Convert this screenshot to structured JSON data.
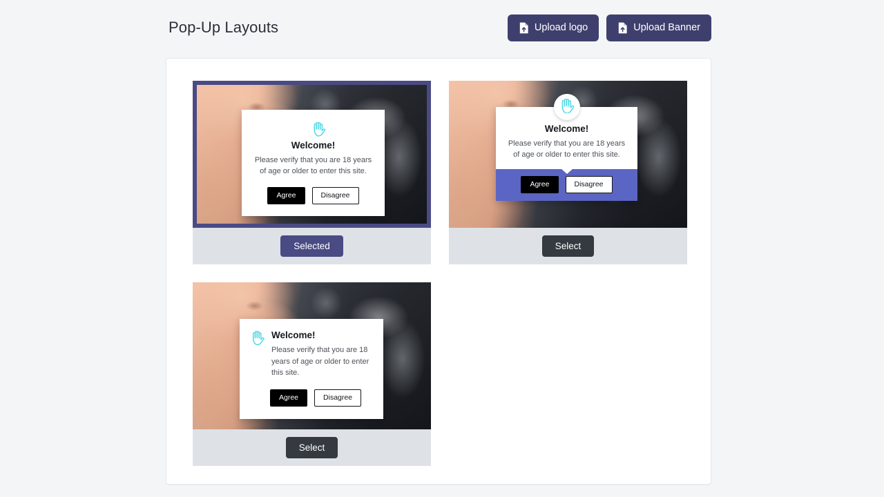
{
  "header": {
    "title": "Pop-Up Layouts",
    "buttons": [
      {
        "label": "Upload logo",
        "icon": "file-arrow-up-icon"
      },
      {
        "label": "Upload Banner",
        "icon": "file-arrow-up-icon"
      }
    ]
  },
  "colors": {
    "page_background": "#f4f5f7",
    "panel_background": "#ffffff",
    "header_button": "#3f3f6e",
    "selected_accent": "#4a4a84",
    "popup_bar_purple": "#5b65c4",
    "select_button": "#343a40",
    "card_footer": "#dee2e6",
    "hand_icon": "#4fd8e8",
    "agree_button": "#000000",
    "disagree_button_border": "#111418"
  },
  "popup_content": {
    "title": "Welcome!",
    "description": "Please verify that you are 18 years of age or older to enter this site.",
    "agree_label": "Agree",
    "disagree_label": "Disagree",
    "icon": "raised-hand-icon"
  },
  "layouts": [
    {
      "id": "layout-centered",
      "name": "Centered pop-up",
      "selected": true,
      "select_label": "Selected",
      "title": "Welcome!",
      "description": "Please verify that you are 18 years of age or older to enter this site.",
      "agree_label": "Agree",
      "disagree_label": "Disagree"
    },
    {
      "id": "layout-badge-bar",
      "name": "Badge icon with purple action bar",
      "selected": false,
      "select_label": "Select",
      "title": "Welcome!",
      "description": "Please verify that you are 18 years of age or older to enter this site.",
      "agree_label": "Agree",
      "disagree_label": "Disagree"
    },
    {
      "id": "layout-left-aligned",
      "name": "Left aligned pop-up",
      "selected": false,
      "select_label": "Select",
      "title": "Welcome!",
      "description": "Please verify that you are 18 years of age or older to enter this site.",
      "agree_label": "Agree",
      "disagree_label": "Disagree"
    }
  ]
}
